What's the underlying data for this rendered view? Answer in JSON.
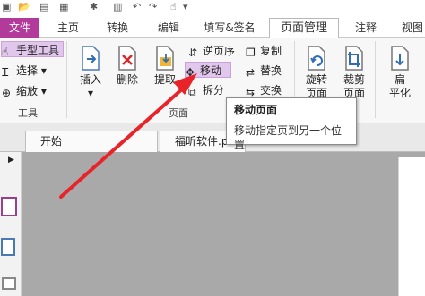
{
  "menu_tabs": [
    "文件",
    "主页",
    "转换",
    "编辑",
    "填写&签名",
    "页面管理",
    "注释",
    "视图"
  ],
  "tools_group": {
    "label": "工具",
    "hand_tool": "手型工具",
    "select": "选择",
    "zoom": "缩放"
  },
  "pages_group": {
    "label": "页面",
    "insert": "插入",
    "delete": "删除",
    "extract": "提取",
    "reverse": "逆页序",
    "move": "移动",
    "split": "拆分",
    "copy": "复制",
    "replace": "替换",
    "swap": "交换"
  },
  "right_buttons": {
    "rotate": "旋转",
    "rotate_sub": "页面",
    "crop": "裁剪",
    "crop_sub": "页面",
    "flatten_top": "扁",
    "flatten": "平化"
  },
  "doc_tabs": [
    "开始",
    "福昕软件.pdf"
  ],
  "tooltip": {
    "title": "移动页面",
    "description": "移动指定页到另一个位置"
  },
  "colors": {
    "file_tab": "#b23a9b",
    "highlight": "#e2c7ec",
    "arrow": "#e8242a",
    "doc_background": "#a9a9a9"
  }
}
